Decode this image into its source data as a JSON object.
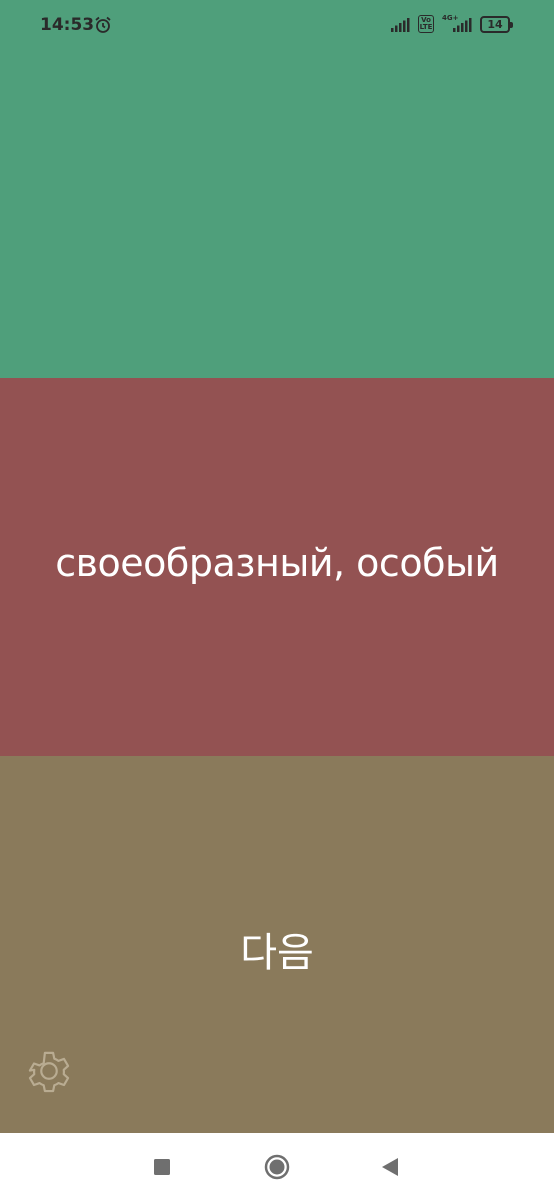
{
  "status_bar": {
    "time": "14:53",
    "volte_top": "Vo",
    "volte_bottom": "LTE",
    "network_type": "4G+",
    "battery_level": "14"
  },
  "card": {
    "translation": "своеобразный, особый",
    "next_label": "다음"
  },
  "colors": {
    "top_panel": "#4f9f7b",
    "middle_panel": "#935252",
    "bottom_panel": "#8a7a5b"
  },
  "icons": {
    "settings": "gear-icon",
    "recents": "square-icon",
    "home": "circle-icon",
    "back": "triangle-back-icon"
  }
}
